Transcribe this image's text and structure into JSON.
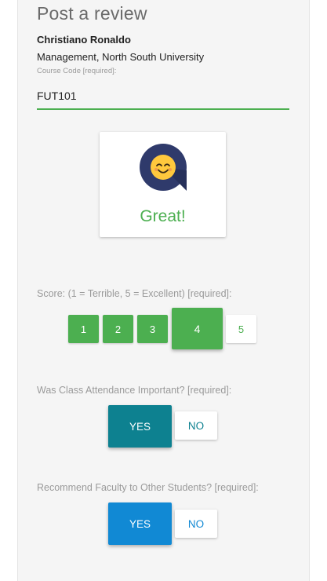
{
  "page": {
    "title": "Post a review"
  },
  "reviewer": {
    "name": "Christiano Ronaldo",
    "department": "Management, North South University"
  },
  "course_code": {
    "label": "Course Code [required]:",
    "value": "FUT101"
  },
  "rating_card": {
    "icon": "smiling-face-icon",
    "text": "Great!",
    "color": "#4caf50"
  },
  "score": {
    "label": "Score: (1 = Terrible, 5 = Excellent) [required]:",
    "options": [
      "1",
      "2",
      "3",
      "4",
      "5"
    ],
    "selected": "4"
  },
  "attendance": {
    "label": "Was Class Attendance Important? [required]:",
    "yes": "YES",
    "no": "NO",
    "selected": "YES",
    "color": "#0d8190"
  },
  "recommend": {
    "label": "Recommend Faculty to Other Students? [required]:",
    "yes": "YES",
    "no": "NO",
    "selected": "YES",
    "color": "#1189d4"
  }
}
